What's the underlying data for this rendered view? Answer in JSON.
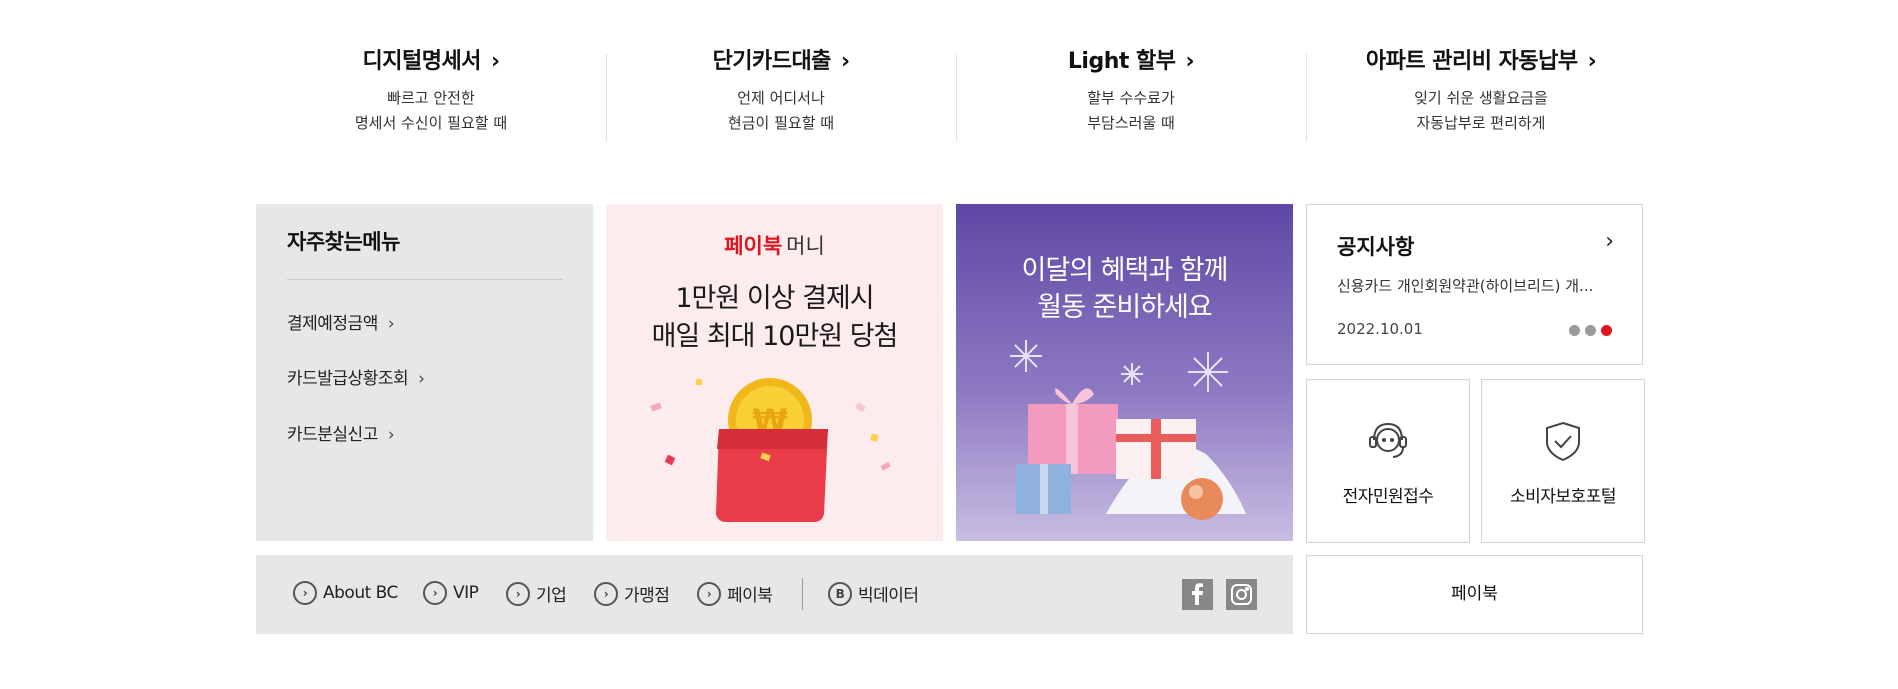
{
  "services": [
    {
      "title": "디지털명세서",
      "line1": "빠르고 안전한",
      "line2": "명세서 수신이 필요할 때"
    },
    {
      "title": "단기카드대출",
      "line1": "언제 어디서나",
      "line2": "현금이 필요할 때"
    },
    {
      "title": "Light 할부",
      "line1": "할부 수수료가",
      "line2": "부담스러울 때"
    },
    {
      "title": "아파트 관리비 자동납부",
      "line1": "잊기 쉬운 생활요금을",
      "line2": "자동납부로 편리하게"
    }
  ],
  "frequent": {
    "title": "자주찾는메뉴",
    "items": [
      "결제예정금액",
      "카드발급상황조회",
      "카드분실신고"
    ]
  },
  "banner1": {
    "brand": "페이북",
    "brand_suffix": "머니",
    "line1": "1만원 이상 결제시",
    "line2": "매일 최대 10만원 당첨"
  },
  "banner2": {
    "line1": "이달의 혜택과 함께",
    "line2": "월동 준비하세요"
  },
  "notice": {
    "title": "공지사항",
    "text": "신용카드 개인회원약관(하이브리드) 개...",
    "date": "2022.10.01",
    "active_dot": 3,
    "dot_active_color": "#e0141e"
  },
  "quick": [
    {
      "label": "전자민원접수",
      "icon": "headset-icon"
    },
    {
      "label": "소비자보호포털",
      "icon": "shield-check-icon"
    }
  ],
  "bottom_links": [
    {
      "label": "About BC",
      "icon": "chevron-circle-icon"
    },
    {
      "label": "VIP",
      "icon": "chevron-circle-icon"
    },
    {
      "label": "기업",
      "icon": "chevron-circle-icon"
    },
    {
      "label": "가맹점",
      "icon": "chevron-circle-icon"
    },
    {
      "label": "페이북",
      "icon": "chevron-circle-icon"
    },
    {
      "label": "빅데이터",
      "icon": "b-circle-icon",
      "glyph": "B"
    }
  ],
  "social": [
    "facebook-icon",
    "instagram-icon"
  ],
  "paybook_button": "페이북",
  "colors": {
    "accent": "#e0141e",
    "panel": "#e7e7e7",
    "banner_purple": "#6a54ad"
  }
}
